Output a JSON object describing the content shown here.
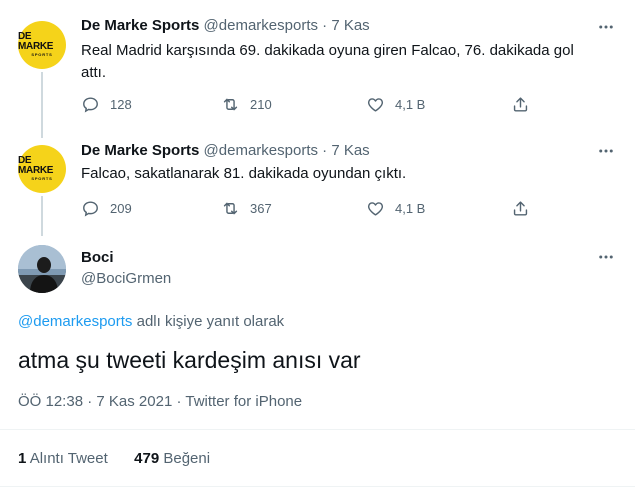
{
  "tweets": [
    {
      "avatar": {
        "logo_main": "DE MARKE",
        "logo_sub": "SPORTS"
      },
      "name": "De Marke Sports",
      "handle": "@demarkesports",
      "date": "7 Kas",
      "sep": "·",
      "text": "Real Madrid karşısında 69. dakikada oyuna giren Falcao, 76. dakikada gol attı.",
      "replies": "128",
      "retweets": "210",
      "likes": "4,1 B"
    },
    {
      "avatar": {
        "logo_main": "DE MARKE",
        "logo_sub": "SPORTS"
      },
      "name": "De Marke Sports",
      "handle": "@demarkesports",
      "date": "7 Kas",
      "sep": "·",
      "text": "Falcao, sakatlanarak 81. dakikada oyundan çıktı.",
      "replies": "209",
      "retweets": "367",
      "likes": "4,1 B"
    }
  ],
  "main_tweet": {
    "name": "Boci",
    "handle": "@BociGrmen",
    "reply_to_handle": "@demarkesports",
    "reply_to_suffix": "adlı kişiye yanıt olarak",
    "text": "atma şu tweeti kardeşim anısı var",
    "time": "ÖÖ 12:38",
    "date": "7 Kas 2021",
    "source": "Twitter for iPhone",
    "sep": "·",
    "stats": {
      "quote_count": "1",
      "quote_label": "Alıntı Tweet",
      "like_count": "479",
      "like_label": "Beğeni"
    }
  },
  "colors": {
    "accent": "#1d9bf0",
    "secondary_text": "#536471",
    "avatar_yellow": "#f5d31a"
  }
}
